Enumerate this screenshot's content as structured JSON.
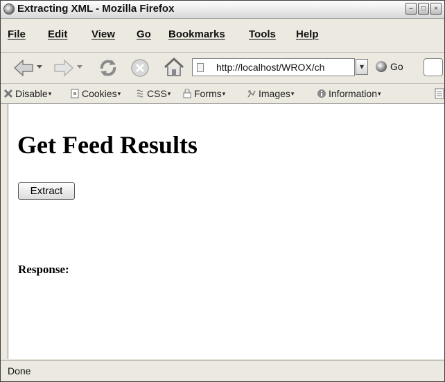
{
  "window": {
    "title": "Extracting XML - Mozilla Firefox"
  },
  "menubar": {
    "items": [
      {
        "label": "File"
      },
      {
        "label": "Edit"
      },
      {
        "label": "View"
      },
      {
        "label": "Go"
      },
      {
        "label": "Bookmarks"
      },
      {
        "label": "Tools"
      },
      {
        "label": "Help"
      }
    ]
  },
  "navbar": {
    "address": "http://localhost/WROX/ch",
    "go_label": "Go",
    "icons": [
      "back-icon",
      "forward-icon",
      "reload-icon",
      "stop-icon",
      "home-icon",
      "search-engine-icon"
    ]
  },
  "devbar": {
    "items": [
      {
        "label": "Disable",
        "icon": "disable-icon"
      },
      {
        "label": "Cookies",
        "icon": "cookies-icon"
      },
      {
        "label": "CSS",
        "icon": "css-icon"
      },
      {
        "label": "Forms",
        "icon": "forms-icon"
      },
      {
        "label": "Images",
        "icon": "images-icon"
      },
      {
        "label": "Information",
        "icon": "information-icon"
      }
    ]
  },
  "page": {
    "heading": "Get Feed Results",
    "button_label": "Extract",
    "response_label": "Response:"
  },
  "status": {
    "text": "Done"
  }
}
